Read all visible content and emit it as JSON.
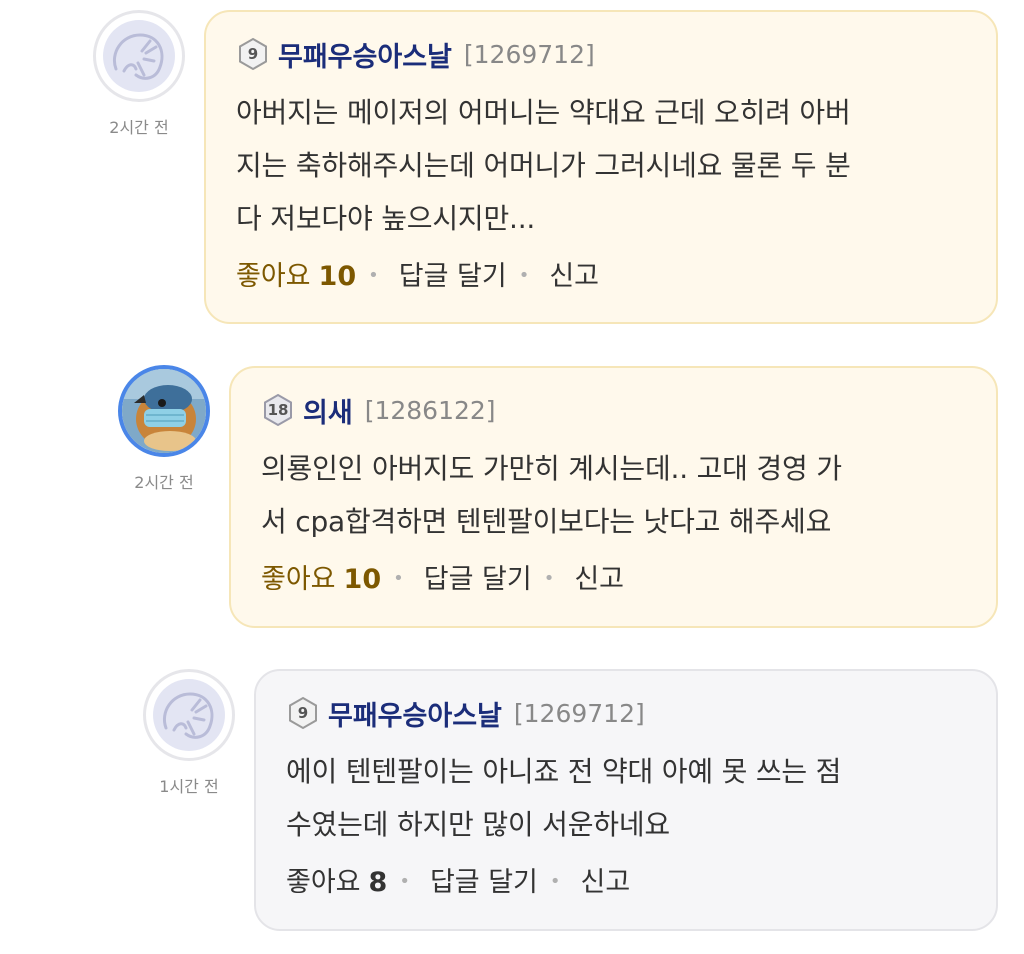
{
  "comments": [
    {
      "time": "2시간 전",
      "level": "9",
      "nickname": "무패우승아스날",
      "user_id": "[1269712]",
      "lines": [
        "아버지는 메이저의 어머니는 약대요 근데 오히려 아버",
        "지는 축하해주시는데 어머니가 그러시네요 물론 두 분",
        "다 저보다야 높으시지만..."
      ],
      "like_label": "좋아요",
      "like_count": "10",
      "reply_label": "답글 달기",
      "report_label": "신고"
    },
    {
      "time": "2시간 전",
      "level": "18",
      "nickname": "의새",
      "user_id": "[1286122]",
      "lines": [
        "의룡인인 아버지도 가만히 계시는데.. 고대 경영 가",
        "서 cpa합격하면 텐텐팔이보다는 낫다고 해주세요"
      ],
      "like_label": "좋아요",
      "like_count": "10",
      "reply_label": "답글 달기",
      "report_label": "신고"
    },
    {
      "time": "1시간 전",
      "level": "9",
      "nickname": "무패우승아스날",
      "user_id": "[1269712]",
      "lines": [
        "에이 텐텐팔이는 아니죠 전 약대 아예 못 쓰는 점",
        "수였는데 하지만 많이 서운하네요"
      ],
      "like_label": "좋아요",
      "like_count": "8",
      "reply_label": "답글 달기",
      "report_label": "신고"
    }
  ],
  "colors": {
    "nickname": "#1b2d7a",
    "liked_yellow": "#7d5800",
    "bubble_yellow": "#fff9ec",
    "bubble_gray": "#f6f6f8",
    "avatar_ring_blue": "#4a86e8"
  }
}
